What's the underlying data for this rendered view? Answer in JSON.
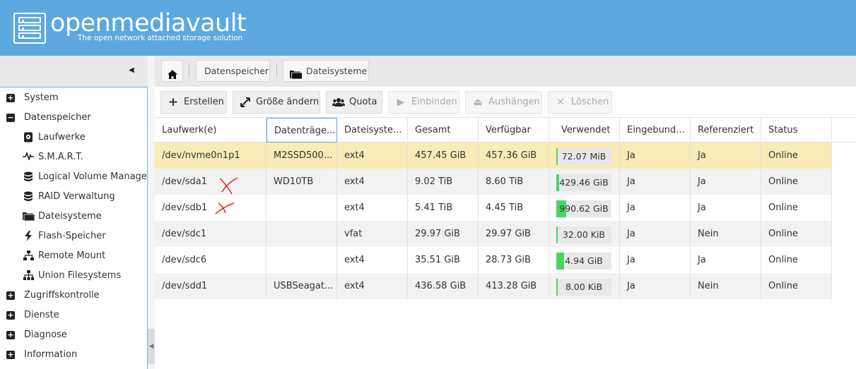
{
  "header": {
    "brand": "openmediavault",
    "tagline": "The open network attached storage solution"
  },
  "sidebar": {
    "items": [
      {
        "label": "System",
        "expander": "+"
      },
      {
        "label": "Datenspeicher",
        "expander": "−"
      },
      {
        "label": "Laufwerke",
        "icon": "disk-icon"
      },
      {
        "label": "S.M.A.R.T.",
        "icon": "pulse-icon"
      },
      {
        "label": "Logical Volume Management",
        "icon": "database-icon"
      },
      {
        "label": "RAID Verwaltung",
        "icon": "database-icon"
      },
      {
        "label": "Dateisysteme",
        "icon": "folder-icon"
      },
      {
        "label": "Flash-Speicher",
        "icon": "bolt-icon"
      },
      {
        "label": "Remote Mount",
        "icon": "sitemap-icon"
      },
      {
        "label": "Union Filesystems",
        "icon": "sitemap-icon"
      },
      {
        "label": "Zugriffskontrolle",
        "expander": "+"
      },
      {
        "label": "Dienste",
        "expander": "+"
      },
      {
        "label": "Diagnose",
        "expander": "+"
      },
      {
        "label": "Information",
        "expander": "+"
      }
    ]
  },
  "breadcrumb": {
    "home_icon": "home-icon",
    "items": [
      "Datenspeicher",
      "Dateisysteme"
    ]
  },
  "toolbar": {
    "buttons": [
      {
        "label": "Erstellen",
        "icon": "plus-icon",
        "enabled": true
      },
      {
        "label": "Größe ändern",
        "icon": "resize-icon",
        "enabled": true
      },
      {
        "label": "Quota",
        "icon": "users-icon",
        "enabled": true
      },
      {
        "label": "Einbinden",
        "icon": "play-icon",
        "enabled": false
      },
      {
        "label": "Aushängen",
        "icon": "eject-icon",
        "enabled": false
      },
      {
        "label": "Löschen",
        "icon": "times-icon",
        "enabled": false
      }
    ]
  },
  "grid": {
    "columns": [
      "Laufwerk(e)",
      "Datenträge...",
      "Dateisyste...",
      "Gesamt",
      "Verfügbar",
      "Verwendet",
      "Eingebund...",
      "Referenziert",
      "Status"
    ],
    "rows": [
      {
        "device": "/dev/nvme0n1p1",
        "label": "M2SSD500...",
        "fs": "ext4",
        "total": "457.45 GiB",
        "available": "457.36 GiB",
        "used": "72.07 MiB",
        "used_fraction": 0.02,
        "mounted": "Ja",
        "referenced": "Ja",
        "status": "Online",
        "selected": true
      },
      {
        "device": "/dev/sda1",
        "label": "WD10TB",
        "fs": "ext4",
        "total": "9.02 TiB",
        "available": "8.60 TiB",
        "used": "429.46 GiB",
        "used_fraction": 0.05,
        "mounted": "Ja",
        "referenced": "Ja",
        "status": "Online",
        "selected": false
      },
      {
        "device": "/dev/sdb1",
        "label": "",
        "fs": "ext4",
        "total": "5.41 TiB",
        "available": "4.45 TiB",
        "used": "990.62 GiB",
        "used_fraction": 0.18,
        "mounted": "Ja",
        "referenced": "Ja",
        "status": "Online",
        "selected": false
      },
      {
        "device": "/dev/sdc1",
        "label": "",
        "fs": "vfat",
        "total": "29.97 GiB",
        "available": "29.97 GiB",
        "used": "32.00 KiB",
        "used_fraction": 0.0,
        "mounted": "Ja",
        "referenced": "Nein",
        "status": "Online",
        "selected": false
      },
      {
        "device": "/dev/sdc6",
        "label": "",
        "fs": "ext4",
        "total": "35.51 GiB",
        "available": "28.73 GiB",
        "used": "4.94 GiB",
        "used_fraction": 0.14,
        "mounted": "Ja",
        "referenced": "Ja",
        "status": "Online",
        "selected": false
      },
      {
        "device": "/dev/sdd1",
        "label": "USBSeagat...",
        "fs": "ext4",
        "total": "436.58 GiB",
        "available": "413.28 GiB",
        "used": "8.00 KiB",
        "used_fraction": 0.0,
        "mounted": "Ja",
        "referenced": "Nein",
        "status": "Online",
        "selected": false
      }
    ]
  },
  "colors": {
    "header": "#5da9df",
    "selected_row": "#fbebb5",
    "alt_row": "#f2f2f2",
    "bar_fill": "#4cd463",
    "annotation": "#e8231e"
  }
}
